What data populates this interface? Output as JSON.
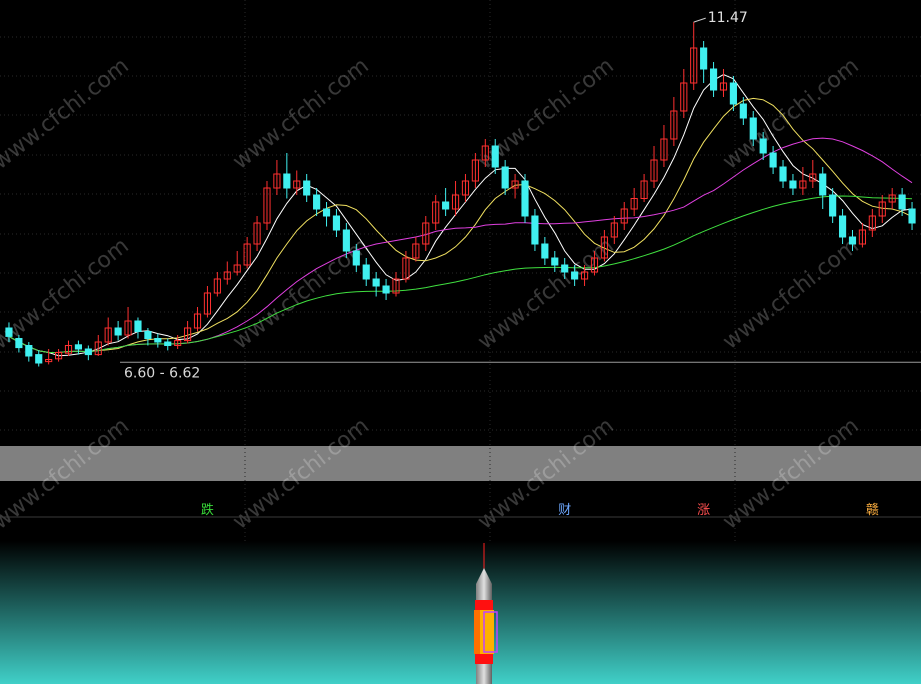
{
  "chart_data": {
    "type": "candlestick",
    "annotations": {
      "high_label": "11.47",
      "range_label": "6.60 - 6.62"
    },
    "price_scale": {
      "ymin": 5.5,
      "ymax": 11.7,
      "reference_line": 6.61
    },
    "candles": [
      [
        7.1,
        6.98,
        7.18,
        6.9
      ],
      [
        6.95,
        6.82,
        7.0,
        6.75
      ],
      [
        6.85,
        6.7,
        6.9,
        6.62
      ],
      [
        6.72,
        6.6,
        6.78,
        6.55
      ],
      [
        6.62,
        6.65,
        6.8,
        6.58
      ],
      [
        6.66,
        6.75,
        6.8,
        6.62
      ],
      [
        6.74,
        6.85,
        6.92,
        6.7
      ],
      [
        6.86,
        6.8,
        6.92,
        6.72
      ],
      [
        6.8,
        6.72,
        6.85,
        6.64
      ],
      [
        6.72,
        6.9,
        7.0,
        6.7
      ],
      [
        6.9,
        7.1,
        7.25,
        6.85
      ],
      [
        7.1,
        7.0,
        7.2,
        6.92
      ],
      [
        7.0,
        7.2,
        7.4,
        6.95
      ],
      [
        7.2,
        7.05,
        7.25,
        6.95
      ],
      [
        7.05,
        6.95,
        7.1,
        6.85
      ],
      [
        6.95,
        6.9,
        7.02,
        6.82
      ],
      [
        6.9,
        6.85,
        6.95,
        6.78
      ],
      [
        6.85,
        6.92,
        7.0,
        6.8
      ],
      [
        6.92,
        7.1,
        7.2,
        6.88
      ],
      [
        7.1,
        7.3,
        7.4,
        7.05
      ],
      [
        7.3,
        7.6,
        7.7,
        7.25
      ],
      [
        7.6,
        7.8,
        7.9,
        7.55
      ],
      [
        7.8,
        7.9,
        8.05,
        7.72
      ],
      [
        7.9,
        8.0,
        8.2,
        7.85
      ],
      [
        8.0,
        8.3,
        8.4,
        7.95
      ],
      [
        8.3,
        8.6,
        8.7,
        8.2
      ],
      [
        8.6,
        9.1,
        9.2,
        8.5
      ],
      [
        9.1,
        9.3,
        9.5,
        9.0
      ],
      [
        9.3,
        9.1,
        9.6,
        8.95
      ],
      [
        9.1,
        9.2,
        9.35,
        9.0
      ],
      [
        9.2,
        9.0,
        9.3,
        8.9
      ],
      [
        9.0,
        8.8,
        9.1,
        8.7
      ],
      [
        8.8,
        8.7,
        8.9,
        8.55
      ],
      [
        8.7,
        8.5,
        8.8,
        8.4
      ],
      [
        8.5,
        8.2,
        8.6,
        8.1
      ],
      [
        8.2,
        8.0,
        8.3,
        7.9
      ],
      [
        8.0,
        7.8,
        8.1,
        7.7
      ],
      [
        7.8,
        7.7,
        7.9,
        7.55
      ],
      [
        7.7,
        7.6,
        7.8,
        7.5
      ],
      [
        7.6,
        7.8,
        7.9,
        7.55
      ],
      [
        7.8,
        8.1,
        8.2,
        7.75
      ],
      [
        8.1,
        8.3,
        8.4,
        8.05
      ],
      [
        8.3,
        8.6,
        8.7,
        8.2
      ],
      [
        8.6,
        8.9,
        9.0,
        8.5
      ],
      [
        8.9,
        8.8,
        9.1,
        8.7
      ],
      [
        8.8,
        9.0,
        9.2,
        8.7
      ],
      [
        9.0,
        9.2,
        9.3,
        8.9
      ],
      [
        9.2,
        9.5,
        9.6,
        9.1
      ],
      [
        9.5,
        9.7,
        9.8,
        9.4
      ],
      [
        9.7,
        9.4,
        9.8,
        9.3
      ],
      [
        9.4,
        9.1,
        9.5,
        9.0
      ],
      [
        9.1,
        9.2,
        9.3,
        8.95
      ],
      [
        9.2,
        8.7,
        9.3,
        8.6
      ],
      [
        8.7,
        8.3,
        8.8,
        8.2
      ],
      [
        8.3,
        8.1,
        8.4,
        8.0
      ],
      [
        8.1,
        8.0,
        8.2,
        7.9
      ],
      [
        8.0,
        7.9,
        8.1,
        7.8
      ],
      [
        7.9,
        7.8,
        8.0,
        7.7
      ],
      [
        7.8,
        7.9,
        8.0,
        7.7
      ],
      [
        7.9,
        8.1,
        8.2,
        7.85
      ],
      [
        8.1,
        8.4,
        8.5,
        8.05
      ],
      [
        8.4,
        8.6,
        8.7,
        8.3
      ],
      [
        8.6,
        8.8,
        8.9,
        8.5
      ],
      [
        8.8,
        8.95,
        9.1,
        8.7
      ],
      [
        8.95,
        9.2,
        9.3,
        8.9
      ],
      [
        9.2,
        9.5,
        9.7,
        9.1
      ],
      [
        9.5,
        9.8,
        10.0,
        9.4
      ],
      [
        9.8,
        10.2,
        10.4,
        9.7
      ],
      [
        10.2,
        10.6,
        10.8,
        10.1
      ],
      [
        10.6,
        11.1,
        11.47,
        10.5
      ],
      [
        11.1,
        10.8,
        11.2,
        10.6
      ],
      [
        10.8,
        10.5,
        10.9,
        10.4
      ],
      [
        10.5,
        10.6,
        10.8,
        10.4
      ],
      [
        10.6,
        10.3,
        10.7,
        10.2
      ],
      [
        10.3,
        10.1,
        10.4,
        10.0
      ],
      [
        10.1,
        9.8,
        10.2,
        9.7
      ],
      [
        9.8,
        9.6,
        9.9,
        9.5
      ],
      [
        9.6,
        9.4,
        9.7,
        9.3
      ],
      [
        9.4,
        9.2,
        9.5,
        9.1
      ],
      [
        9.2,
        9.1,
        9.3,
        9.0
      ],
      [
        9.1,
        9.2,
        9.4,
        9.0
      ],
      [
        9.2,
        9.3,
        9.5,
        9.1
      ],
      [
        9.3,
        9.0,
        9.4,
        8.8
      ],
      [
        9.0,
        8.7,
        9.1,
        8.6
      ],
      [
        8.7,
        8.4,
        8.8,
        8.3
      ],
      [
        8.4,
        8.3,
        8.5,
        8.2
      ],
      [
        8.3,
        8.5,
        8.6,
        8.25
      ],
      [
        8.5,
        8.7,
        8.8,
        8.4
      ],
      [
        8.7,
        8.9,
        9.0,
        8.6
      ],
      [
        8.9,
        9.0,
        9.1,
        8.8
      ],
      [
        9.0,
        8.8,
        9.1,
        8.7
      ],
      [
        8.8,
        8.6,
        8.9,
        8.5
      ]
    ],
    "ma_colors": [
      "#ffffff",
      "#f0e060",
      "#e040e0",
      "#40e040"
    ],
    "ma_periods": [
      5,
      10,
      20,
      60
    ],
    "markers": [
      {
        "text": "跌",
        "color": "#38d838",
        "candle": 20
      },
      {
        "text": "财",
        "color": "#6ea8ff",
        "candle": 56
      },
      {
        "text": "涨",
        "color": "#ff5050",
        "candle": 70
      },
      {
        "text": "赣",
        "color": "#ffb040",
        "candle": 87
      }
    ],
    "watermark_text": "www.cfchi.com",
    "colors": {
      "up": "#ff3030",
      "down": "#40f0f0",
      "band": "#808080",
      "gradient_top": "#000000",
      "gradient_bottom": "#40d0c8",
      "grid": "#2a2a2a"
    }
  }
}
